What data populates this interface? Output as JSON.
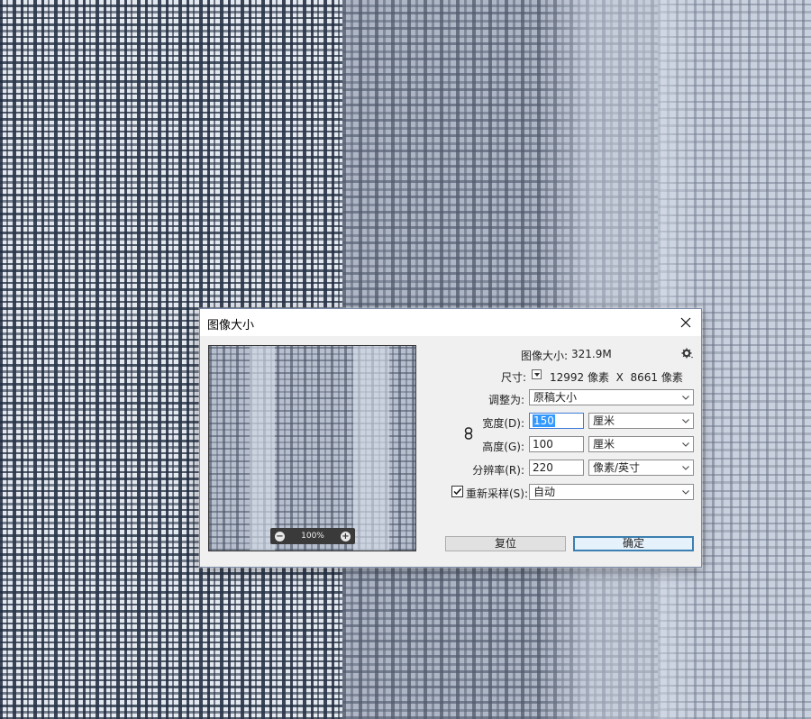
{
  "dialog": {
    "title": "图像大小",
    "close_icon": "close-icon",
    "gear_icon": "gear-icon",
    "image_size_label": "图像大小:",
    "image_size_value": "321.9M",
    "dimensions_label": "尺寸:",
    "dimensions_value": "12992 像素  X  8661 像素",
    "fit_to_label": "调整为:",
    "fit_to_value": "原稿大小",
    "width_label": "宽度(D):",
    "width_value": "150",
    "width_unit": "厘米",
    "height_label": "高度(G):",
    "height_value": "100",
    "height_unit": "厘米",
    "resolution_label": "分辨率(R):",
    "resolution_value": "220",
    "resolution_unit": "像素/英寸",
    "resample_label": "重新采样(S):",
    "resample_checked": true,
    "resample_value": "自动",
    "reset_label": "复位",
    "ok_label": "确定"
  },
  "preview": {
    "zoom_level": "100%",
    "zoom_out_icon": "zoom-out-icon",
    "zoom_in_icon": "zoom-in-icon"
  },
  "colors": {
    "accent": "#3399ff",
    "dialog_bg": "#f0f0f0",
    "pattern_dark": "#1e2a3e",
    "pattern_light": "#c9d0de"
  }
}
